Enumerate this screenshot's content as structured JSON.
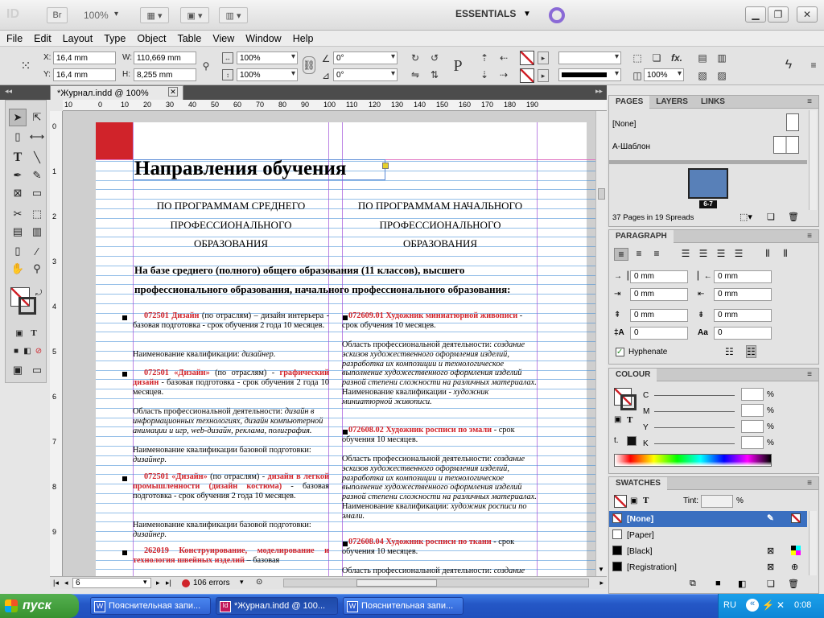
{
  "app": {
    "logo": "ID",
    "bridge": "Br",
    "zoom": "100%",
    "workspace": "ESSENTIALS"
  },
  "menu": [
    "File",
    "Edit",
    "Layout",
    "Type",
    "Object",
    "Table",
    "View",
    "Window",
    "Help"
  ],
  "control": {
    "x_label": "X:",
    "x": "16,4 mm",
    "y_label": "Y:",
    "y": "16,4 mm",
    "w_label": "W:",
    "w": "110,669 mm",
    "h_label": "H:",
    "h": "8,255 mm",
    "scale_x": "100%",
    "scale_y": "100%",
    "rotate": "0°",
    "shear": "0°",
    "stroke_pct": "100%"
  },
  "document": {
    "tab": "*Журнал.indd @ 100%"
  },
  "ruler": {
    "h_ticks": [
      "10",
      "0",
      "10",
      "20",
      "30",
      "40",
      "50",
      "60",
      "70",
      "80",
      "90",
      "100",
      "110",
      "120",
      "130",
      "140",
      "150",
      "160",
      "170",
      "180",
      "190"
    ],
    "v_ticks": [
      "0",
      "1",
      "2",
      "3",
      "4",
      "5",
      "6",
      "7",
      "8",
      "9"
    ]
  },
  "page": {
    "title": "Направления обучения",
    "col1_heading": [
      "ПО ПРОГРАММАМ СРЕДНЕГО",
      "ПРОФЕССИОНАЛЬНОГО",
      "ОБРАЗОВАНИЯ"
    ],
    "col2_heading": [
      "ПО ПРОГРАММАМ НАЧАЛЬНОГО",
      "ПРОФЕССИОНАЛЬНОГО",
      "ОБРАЗОВАНИЯ"
    ],
    "intro": [
      "На базе среднего (полного) общего образования (11 классов), высшего",
      "профессионального образования, начального профессионального образования:"
    ],
    "left": [
      {
        "code": "072501 Дизайн",
        "rest": " (по отраслям) – дизайн интерьера - базовая подготовка - срок обучения 2 года 10 месяцев."
      },
      {
        "plain": "Наименование квалификации: ",
        "italic": "дизайнер."
      },
      {
        "code": "072501 «Дизайн»",
        "rest": " (по отраслям) - ",
        "code2": "графический дизайн",
        "rest2": " - базовая подготовка - срок обучения 2 года 10 месяцев."
      },
      {
        "plain": "Область профессиональной деятельности: ",
        "italic": "дизайн в информационных технологиях, дизайн компьютерной анимации и игр, web-дизайн, реклама, полиграфия."
      },
      {
        "plain": "Наименование квалификации базовой подготовки: ",
        "italic": "дизайнер."
      },
      {
        "code": "072501 «Дизайн»",
        "rest": " (по отраслям) - ",
        "code2": "дизайн в легкой промышленности (дизайн костюма)",
        "rest2": " - базовая подготовка - срок обучения 2 года 10 месяцев."
      },
      {
        "plain": "Наименование квалификации базовой подготовки: ",
        "italic": "дизайнер."
      },
      {
        "code": "262019 Конструирование, моделирование и технология швейных изделий",
        "rest": " – базовая"
      }
    ],
    "right": [
      {
        "code": "072609.01 Художник миниатюрной живописи",
        "rest": " - срок обучения 10 месяцев."
      },
      {
        "plain": "Область профессиональной деятельности: ",
        "italic": "создание эскизов художественного оформления изделий, разработка их композиции и технологическое выполнение художественного оформления изделий разной степени сложности на различных материалах."
      },
      {
        "plain": "Наименование квалификации - ",
        "italic": "художник миниатюрной живописи."
      },
      {
        "code": "072608.02 Художник росписи по эмали",
        "rest": " - срок обучения 10 месяцев."
      },
      {
        "plain": "Область профессиональной деятельности: ",
        "italic": "создание эскизов художественного оформления изделий, разработка их композиции и технологическое выполнение художественного оформления изделий разной степени сложности на различных материалах."
      },
      {
        "plain": "Наименование квалификации: ",
        "italic": "художник росписи по эмали."
      },
      {
        "code": "072608.04 Художник росписи по ткани",
        "rest": " - срок обучения 10 месяцев."
      },
      {
        "plain": "Область профессиональной деятельности: ",
        "italic": "создание"
      }
    ]
  },
  "status": {
    "page": "6",
    "errors": "106 errors"
  },
  "pages_panel": {
    "tabs": [
      "PAGES",
      "LAYERS",
      "LINKS"
    ],
    "none": "[None]",
    "master": "A-Шаблон",
    "spread_label": "6-7",
    "summary": "37 Pages in 19 Spreads"
  },
  "paragraph_panel": {
    "title": "PARAGRAPH",
    "left_indent": "0 mm",
    "right_indent": "0 mm",
    "first_indent": "0 mm",
    "last_indent": "0 mm",
    "space_before": "0 mm",
    "space_after": "0 mm",
    "drop_lines": "0",
    "drop_chars": "0",
    "hyphenate": "Hyphenate"
  },
  "colour_panel": {
    "title": "COLOUR",
    "channels": [
      "C",
      "M",
      "Y",
      "K"
    ],
    "pct": "%"
  },
  "swatches_panel": {
    "title": "SWATCHES",
    "tint_label": "Tint:",
    "pct": "%",
    "items": [
      "[None]",
      "[Paper]",
      "[Black]",
      "[Registration]"
    ]
  },
  "taskbar": {
    "start": "пуск",
    "tasks": [
      "Пояснительная запи...",
      "*Журнал.indd @ 100...",
      "Пояснительная запи..."
    ],
    "lang": "RU",
    "time": "0:08"
  },
  "colors": {
    "accent_red": "#d0232a",
    "selected_swatch": "#3a6fc0",
    "taskbar_blue": "#2457c6"
  }
}
